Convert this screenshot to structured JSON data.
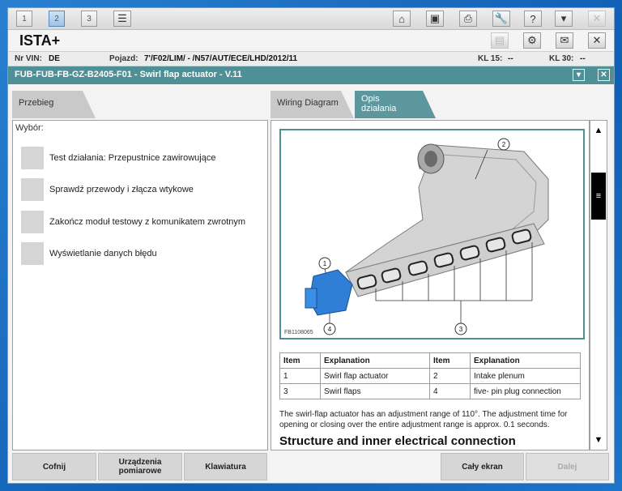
{
  "toolbar": {
    "tabs": [
      "1",
      "2",
      "3"
    ],
    "icons": [
      "list-icon",
      "home-icon",
      "diagnosis-icon",
      "print-icon",
      "wrench-icon",
      "help-icon",
      "minimize-icon",
      "close-icon"
    ]
  },
  "titlebar": {
    "app_title": "ISTA+",
    "icons": [
      "document-icon",
      "gear-icon",
      "mail-icon",
      "close-icon"
    ]
  },
  "vehicle": {
    "vin_label": "Nr VIN:",
    "vin_value": "DE",
    "vehicle_label": "Pojazd:",
    "vehicle_value": "7'/F02/LIM/ - /N57/AUT/ECE/LHD/2012/11",
    "kl15_label": "KL 15:",
    "kl15_value": "--",
    "kl30_label": "KL 30:",
    "kl30_value": "--"
  },
  "module": {
    "title": "FUB-FUB-FB-GZ-B2405-F01 - Swirl flap actuator - V.11"
  },
  "tabs": {
    "przebieg": "Przebieg",
    "wiring": "Wiring Diagram",
    "opis": "Opis działania"
  },
  "left": {
    "header": "Wybór:",
    "steps": [
      "Test działania: Przepustnice zawirowujące",
      "Sprawdź przewody i złącza wtykowe",
      "Zakończ moduł testowy z komunikatem zwrotnym",
      "Wyświetlanie danych błędu"
    ]
  },
  "figure": {
    "code": "FB1108065",
    "callouts": [
      "1",
      "2",
      "3",
      "4"
    ]
  },
  "table": {
    "headers": [
      "Item",
      "Explanation",
      "Item",
      "Explanation"
    ],
    "rows": [
      [
        "1",
        "Swirl flap actuator",
        "2",
        "Intake plenum"
      ],
      [
        "3",
        "Swirl flaps",
        "4",
        "five- pin plug connection"
      ]
    ]
  },
  "content": {
    "description": "The swirl-flap actuator has an adjustment range of 110°. The adjustment time for opening or closing over the entire adjustment range is approx. 0.1 seconds.",
    "heading": "Structure and inner electrical connection"
  },
  "bottom": {
    "cofnij": "Cofnij",
    "urzadzenia": "Urządzenia pomiarowe",
    "klawiatura": "Klawiatura",
    "caly_ekran": "Cały ekran",
    "dalej": "Dalej"
  },
  "colors": {
    "accent": "#4f8f96",
    "actuator_blue": "#2f7fd6"
  }
}
